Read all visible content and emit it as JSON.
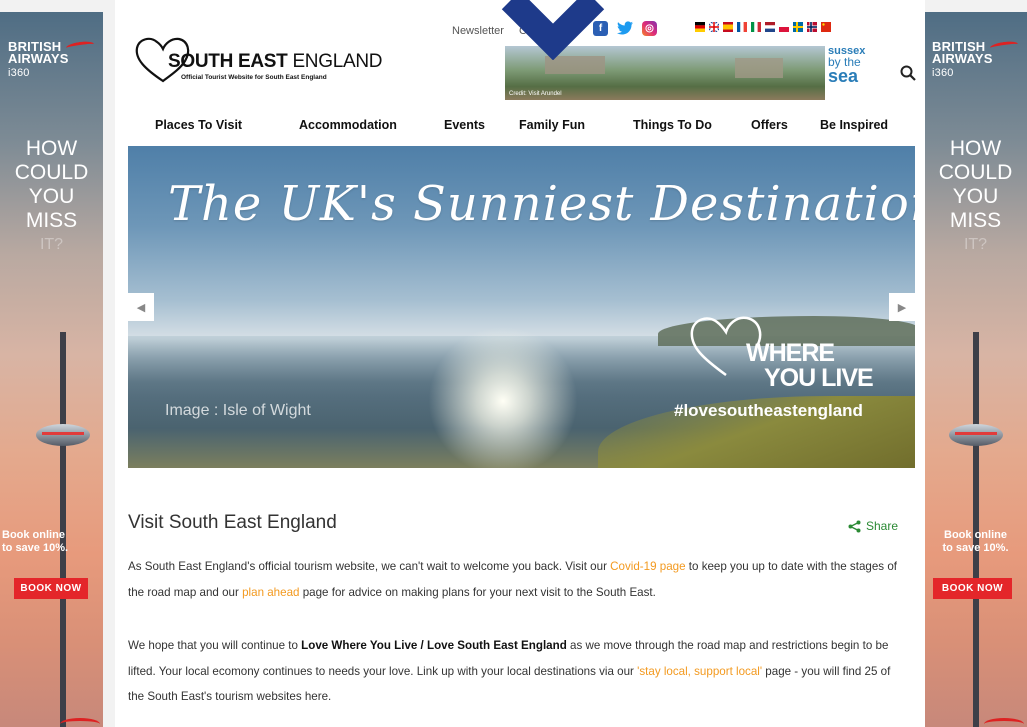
{
  "ads": {
    "brand": "BRITISH",
    "brand2": "AIRWAYS",
    "product": "i360",
    "headline_lines": [
      "HOW",
      "COULD",
      "YOU",
      "MISS",
      "IT?"
    ],
    "offer_line1": "Book online",
    "offer_line2": "to save 10%.",
    "cta": "BOOK NOW"
  },
  "header": {
    "logo_bold": "SOUTH EAST",
    "logo_light": "ENGLAND",
    "logo_tagline": "Official Tourist Website for South East England",
    "top_links": [
      "Newsletter",
      "C"
    ],
    "banner_credit": "Credit: Visit Arundel",
    "sussex_line1": "sussex",
    "sussex_line2": "by the",
    "sussex_line3": "sea"
  },
  "nav": {
    "items": [
      "Places To Visit",
      "Accommodation",
      "Events",
      "Family Fun",
      "Things To Do",
      "Offers",
      "Be Inspired"
    ]
  },
  "hero": {
    "title": "The UK's Sunniest Destination",
    "caption": "Image : Isle of Wight",
    "where1": "WHERE",
    "where2": "YOU LIVE",
    "hashtag": "#lovesoutheastengland"
  },
  "content": {
    "heading": "Visit South East England",
    "share": "Share",
    "p1_a": "As South East England's official tourism website, we can't wait to welcome you back. Visit our ",
    "p1_link1": "Covid-19 page",
    "p1_b": " to keep you up to date with the stages of the road map and our ",
    "p1_link2": "plan ahead",
    "p1_c": " page for advice on making plans for your next visit to the South East.",
    "p2_a": "We hope that you will continue to ",
    "p2_bold": "Love Where You Live / Love South East England",
    "p2_b": " as we move through the road map and restrictions begin to be lifted.  Your local ecomony continues to needs your love.   Link up with your local destinations via our ",
    "p2_link": "'stay local, support local'",
    "p2_c": " page  - you will find 25 of the South East's tourism websites here."
  },
  "colors": {
    "accent_orange": "#f39a20",
    "share_green": "#2b8a34",
    "ad_red": "#e4262a",
    "overlay_arrow": "#1e3a8a"
  }
}
